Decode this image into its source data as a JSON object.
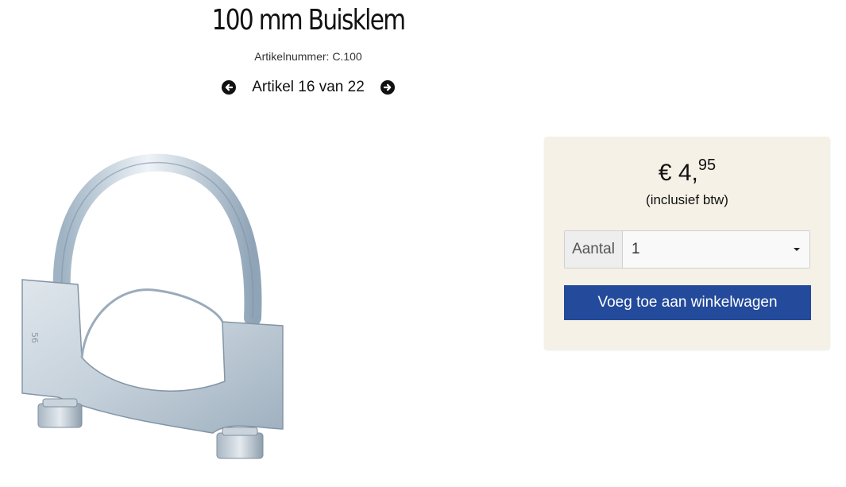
{
  "product": {
    "title": "100 mm Buisklem",
    "sku_line": "Artikelnummer: C.100",
    "image_alt": "clamp-image"
  },
  "pager": {
    "text": "Artikel 16 van 22",
    "prev_icon": "arrow-circle-left-icon",
    "next_icon": "arrow-circle-right-icon"
  },
  "buy_box": {
    "price_main": "€ 4,",
    "price_cents": "95",
    "vat_note": "(inclusief btw)",
    "quantity_label": "Aantal",
    "quantity_value": "1",
    "add_to_cart_label": "Voeg toe aan winkelwagen",
    "button_color": "#234a9b",
    "panel_color": "#f5f1e6"
  }
}
